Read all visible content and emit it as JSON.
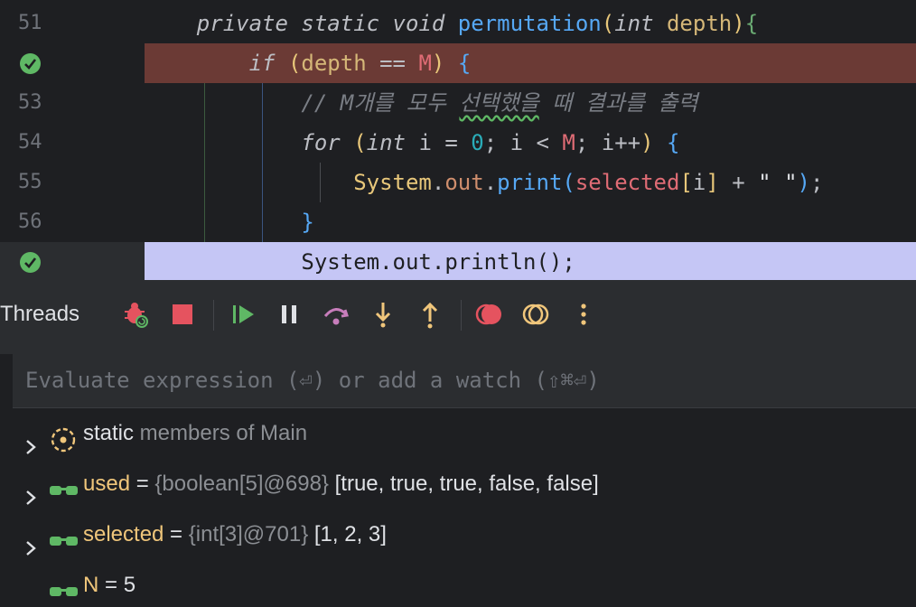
{
  "editor": {
    "lines": [
      {
        "num": "51",
        "tokens": [
          {
            "t": "    "
          },
          {
            "t": "private static void ",
            "c": "it"
          },
          {
            "t": "permutation",
            "c": "fn"
          },
          {
            "t": "(",
            "c": "br1"
          },
          {
            "t": "int ",
            "c": "it"
          },
          {
            "t": "depth",
            "c": "param"
          },
          {
            "t": ")",
            "c": "br1"
          },
          {
            "t": "{",
            "c": "str"
          }
        ]
      },
      {
        "num": "",
        "marker": "breakpoint",
        "tokens": [
          {
            "t": "        "
          },
          {
            "t": "if ",
            "c": "it"
          },
          {
            "t": "(",
            "c": "br1"
          },
          {
            "t": "depth",
            "c": "param"
          },
          {
            "t": " == "
          },
          {
            "t": "M",
            "c": "const"
          },
          {
            "t": ") ",
            "c": "br1"
          },
          {
            "t": "{",
            "c": "br3"
          }
        ]
      },
      {
        "num": "53",
        "tokens": [
          {
            "t": "            "
          },
          {
            "t": "// M개를 모두 ",
            "c": "cmt"
          },
          {
            "t": "선택했을",
            "c": "cmt squiggle"
          },
          {
            "t": " 때 결과를 출력",
            "c": "cmt"
          }
        ]
      },
      {
        "num": "54",
        "tokens": [
          {
            "t": "            "
          },
          {
            "t": "for ",
            "c": "it"
          },
          {
            "t": "(",
            "c": "br1"
          },
          {
            "t": "int ",
            "c": "it"
          },
          {
            "t": "i = "
          },
          {
            "t": "0",
            "c": "num"
          },
          {
            "t": "; i < "
          },
          {
            "t": "M",
            "c": "const"
          },
          {
            "t": "; i++"
          },
          {
            "t": ") ",
            "c": "br1"
          },
          {
            "t": "{",
            "c": "br3"
          }
        ]
      },
      {
        "num": "55",
        "tokens": [
          {
            "t": "                "
          },
          {
            "t": "System",
            "c": "cls"
          },
          {
            "t": "."
          },
          {
            "t": "out",
            "c": "kw"
          },
          {
            "t": "."
          },
          {
            "t": "print",
            "c": "fn"
          },
          {
            "t": "(",
            "c": "br3"
          },
          {
            "t": "selected",
            "c": "const"
          },
          {
            "t": "[",
            "c": "br1"
          },
          {
            "t": "i"
          },
          {
            "t": "]",
            "c": "br1"
          },
          {
            "t": " + "
          },
          {
            "t": "\" \"",
            "c": "vplain"
          },
          {
            "t": ")",
            "c": "br3"
          },
          {
            "t": ";"
          }
        ]
      },
      {
        "num": "56",
        "tokens": [
          {
            "t": "            "
          },
          {
            "t": "}",
            "c": "br3"
          }
        ]
      },
      {
        "num": "",
        "marker": "current",
        "tokens": [
          {
            "t": "            System.out.println();"
          }
        ]
      }
    ]
  },
  "toolbar": {
    "tab_label": "Threads",
    "buttons": [
      {
        "name": "debug-bug-icon",
        "color": "#e5535f"
      },
      {
        "name": "stop-icon",
        "color": "#e5535f"
      },
      {
        "name": "resume-icon",
        "color": "#5fb865"
      },
      {
        "name": "pause-icon",
        "color": "#dfe1e5"
      },
      {
        "name": "step-over-icon",
        "color": "#c77dbb"
      },
      {
        "name": "step-into-icon",
        "color": "#f0c67b"
      },
      {
        "name": "step-out-icon",
        "color": "#f0c67b"
      },
      {
        "name": "view-breakpoints-icon",
        "color": "#e5535f"
      },
      {
        "name": "mute-breakpoints-icon",
        "color": "#f0c67b"
      },
      {
        "name": "more-options-icon",
        "color": "#f0c67b"
      }
    ]
  },
  "variables": {
    "eval_placeholder": "Evaluate expression (⏎) or add a watch (⇧⌘⏎)",
    "items": [
      {
        "expandable": true,
        "icon": "static-members-icon",
        "name": "static",
        "meta": " members of Main",
        "value": ""
      },
      {
        "expandable": true,
        "icon": "watch-glasses-icon",
        "name": "used",
        "eq": " = ",
        "meta": "{boolean[5]@698}",
        "value": " [true, true, true, false, false]"
      },
      {
        "expandable": true,
        "icon": "watch-glasses-icon",
        "name": "selected",
        "eq": " = ",
        "meta": "{int[3]@701}",
        "value": " [1, 2, 3]"
      },
      {
        "expandable": false,
        "icon": "watch-glasses-icon",
        "name": "N",
        "eq": " = ",
        "meta": "",
        "value": "5"
      }
    ]
  },
  "colors": {
    "breakpoint_line": "#6b3a35",
    "current_line": "#c5c6f5",
    "check_marker": "#5fb865"
  }
}
